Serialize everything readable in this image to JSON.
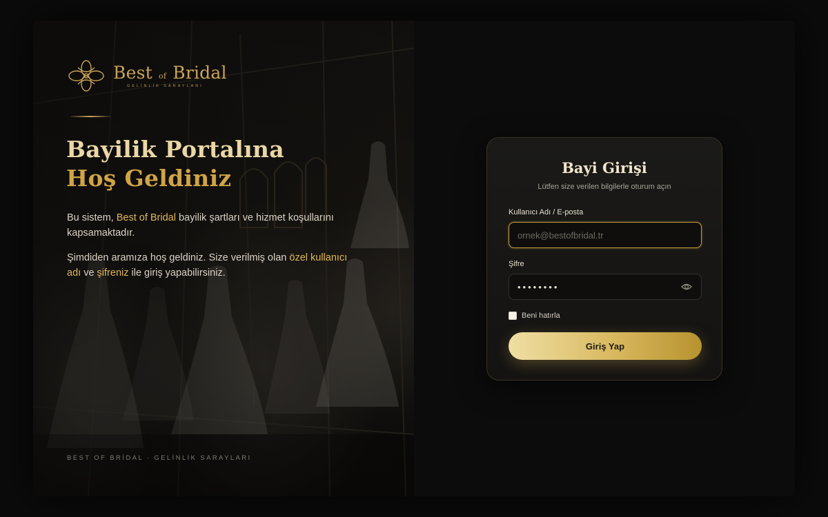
{
  "brand": {
    "name_prefix": "Best",
    "name_of": "of",
    "name_suffix": "Bridal",
    "tagline": "GELİNLİK SARAYLARI",
    "gold": "#c9a45a"
  },
  "hero": {
    "title_line1": "Bayilik Portalına",
    "title_line2": "Hoş Geldiniz",
    "p1_a": "Bu sistem, ",
    "p1_highlight": "Best of Bridal",
    "p1_b": " bayilik şartları ve hizmet koşullarını kapsamaktadır.",
    "p2_a": "Şimdiden aramıza hoş geldiniz. Size verilmiş olan ",
    "p2_h1": "özel kullanıcı adı",
    "p2_b": " ve ",
    "p2_h2": "şifreniz",
    "p2_c": " ile giriş yapabilirsiniz.",
    "footer": "BEST OF BRİDAL · GELİNLİK SARAYLARI"
  },
  "login": {
    "title": "Bayi Girişi",
    "subtitle": "Lütfen size verilen bilgilerle oturum açın",
    "username_label": "Kullanıcı Adı / E-posta",
    "username_placeholder": "ornek@bestofbridal.tr",
    "password_label": "Şifre",
    "password_value": "••••••••",
    "password_toggle_icon": "eye-icon",
    "remember_label": "Beni hatırla",
    "remember_checked": false,
    "submit_label": "Giriş Yap"
  }
}
